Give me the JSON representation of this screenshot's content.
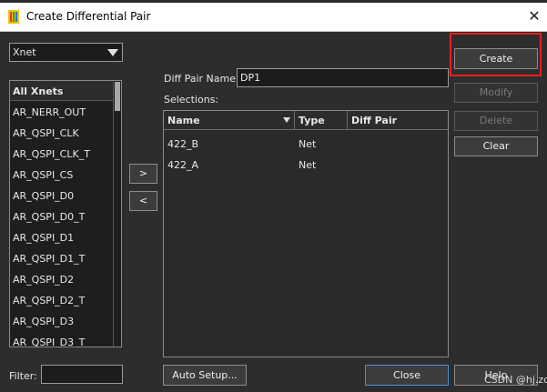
{
  "window": {
    "title": "Create Differential Pair",
    "close_glyph": "✕"
  },
  "net_type": {
    "selected": "Xnet"
  },
  "net_list": {
    "header": "All Xnets",
    "items": [
      "AR_NERR_OUT",
      "AR_QSPI_CLK",
      "AR_QSPI_CLK_T",
      "AR_QSPI_CS",
      "AR_QSPI_D0",
      "AR_QSPI_D0_T",
      "AR_QSPI_D1",
      "AR_QSPI_D1_T",
      "AR_QSPI_D2",
      "AR_QSPI_D2_T",
      "AR_QSPI_D3",
      "AR_QSPI_D3_T"
    ]
  },
  "filter": {
    "label": "Filter:",
    "value": ""
  },
  "transfer": {
    "add_label": ">",
    "remove_label": "<"
  },
  "diff_pair": {
    "name_label": "Diff Pair Name:",
    "name_value": "DP1"
  },
  "selections": {
    "label": "Selections:",
    "columns": [
      "Name",
      "Type",
      "Diff Pair"
    ],
    "rows": [
      {
        "name": "422_B",
        "type": "Net",
        "diff_pair": ""
      },
      {
        "name": "422_A",
        "type": "Net",
        "diff_pair": ""
      }
    ]
  },
  "actions": {
    "create": "Create",
    "modify": "Modify",
    "delete": "Delete",
    "clear": "Clear"
  },
  "footer": {
    "auto_setup": "Auto Setup...",
    "close": "Close",
    "help": "Help"
  },
  "watermark": "CSDN @hj.zc",
  "colors": {
    "highlight_box": "#e52020",
    "dialog_bg": "#2d2d2d"
  }
}
